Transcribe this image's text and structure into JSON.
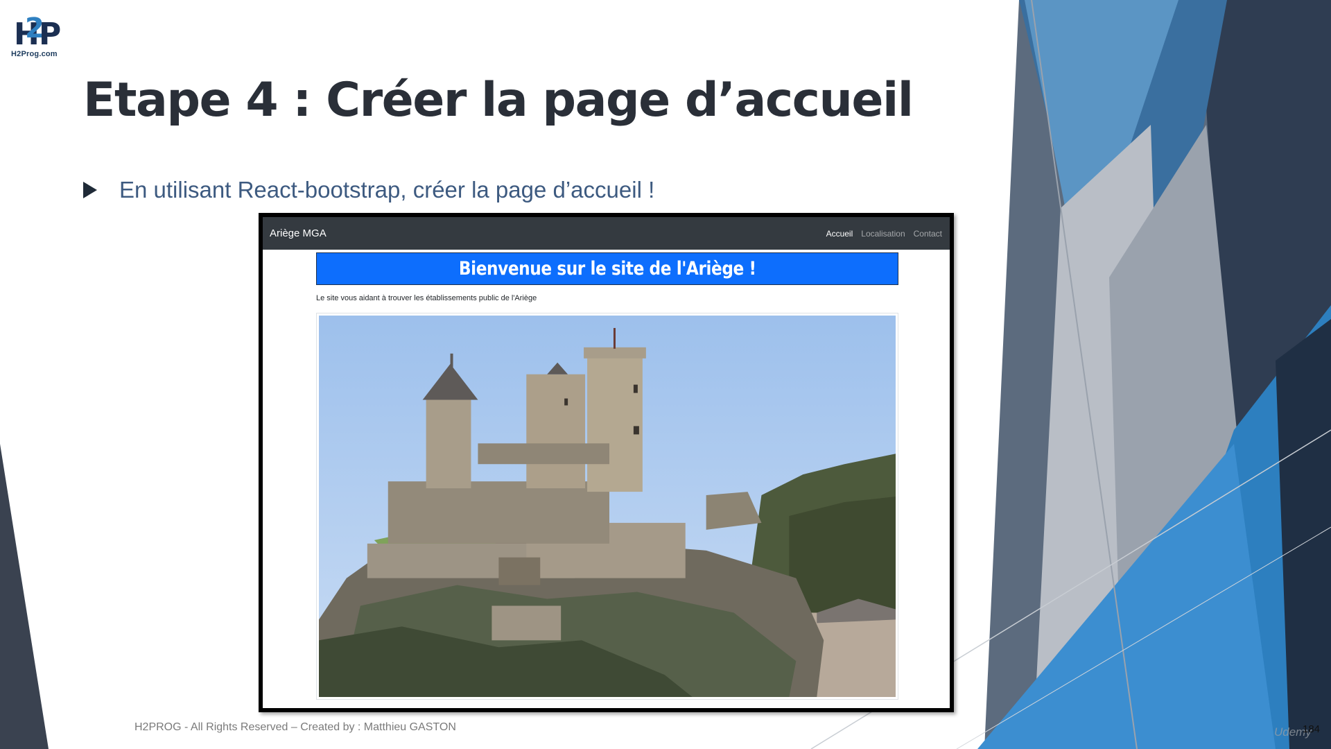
{
  "logo": {
    "mark": "H2P",
    "domain": "H2Prog.com"
  },
  "slide": {
    "title": "Etape 4 : Créer la page d’accueil",
    "bullets": [
      "En utilisant React-bootstrap, créer la page d’accueil !"
    ],
    "footer": "H2PROG - All Rights Reserved – Created by : Matthieu GASTON",
    "page_number": "184",
    "watermark": "Udemy"
  },
  "site": {
    "brand": "Ariège MGA",
    "nav": [
      {
        "label": "Accueil",
        "active": true
      },
      {
        "label": "Localisation",
        "active": false
      },
      {
        "label": "Contact",
        "active": false
      }
    ],
    "banner": "Bienvenue sur le site de l'Ariège !",
    "subtitle": "Le site vous aidant à trouver les établissements public de l'Ariège",
    "image": "castle-photo"
  },
  "colors": {
    "navbar": "#343a40",
    "banner": "#0d6efd",
    "title": "#2a2f38",
    "bullet_text": "#3d5a80",
    "accent_blue": "#2f80c1",
    "dark_slate": "#3a4250"
  }
}
